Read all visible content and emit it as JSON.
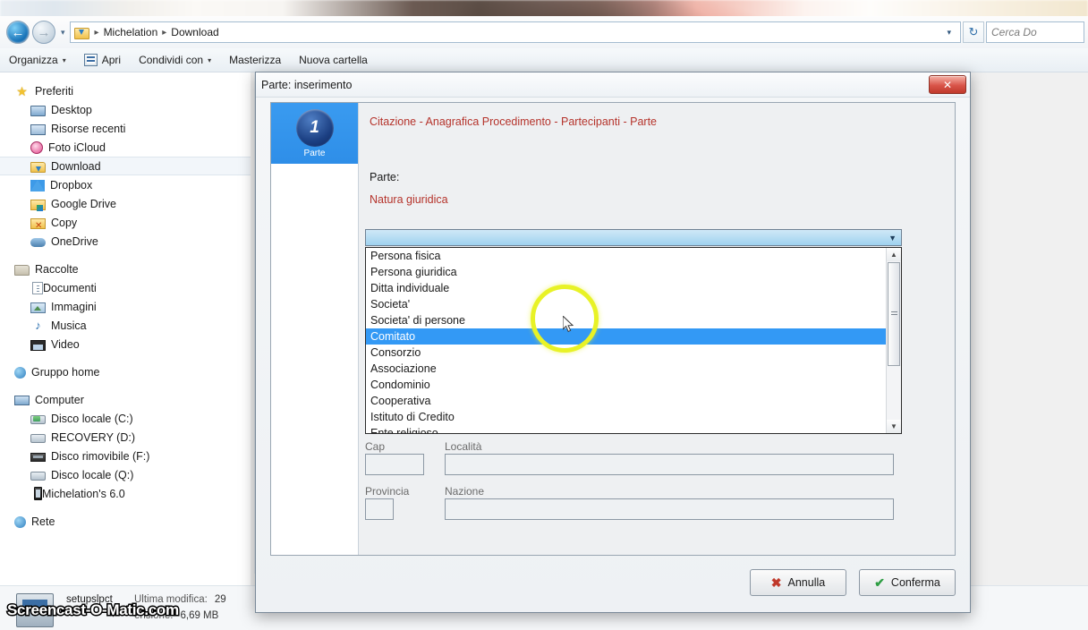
{
  "explorer": {
    "address": {
      "crumbs": [
        "Michelation",
        "Download"
      ],
      "separator": "▸",
      "history_caret": "▾",
      "dropdown_caret": "▾",
      "refresh_icon": "refresh-icon",
      "back_icon": "back-arrow-icon",
      "forward_icon": "forward-arrow-icon",
      "folder_icon": "download-folder-icon"
    },
    "search": {
      "placeholder": "Cerca Do",
      "value": ""
    },
    "commandbar": [
      {
        "label": "Organizza",
        "caret": "▾",
        "icon": ""
      },
      {
        "label": "Apri",
        "caret": "",
        "icon": "open-file-icon"
      },
      {
        "label": "Condividi con",
        "caret": "▾",
        "icon": ""
      },
      {
        "label": "Masterizza",
        "caret": "",
        "icon": ""
      },
      {
        "label": "Nuova cartella",
        "caret": "",
        "icon": ""
      }
    ],
    "sidebar": [
      {
        "label": "Preferiti",
        "icon": "star-icon",
        "level": "root",
        "selected": false,
        "cls": "ic-star"
      },
      {
        "label": "Desktop",
        "icon": "monitor-icon",
        "level": "child",
        "selected": false,
        "cls": "ic-monitor"
      },
      {
        "label": "Risorse recenti",
        "icon": "recent-places-icon",
        "level": "child",
        "selected": false,
        "cls": "ic-net"
      },
      {
        "label": "Foto iCloud",
        "icon": "icloud-photos-icon",
        "level": "child",
        "selected": false,
        "cls": "ic-icloud"
      },
      {
        "label": "Download",
        "icon": "download-folder-icon",
        "level": "child",
        "selected": true,
        "cls": "ic-folder dl"
      },
      {
        "label": "Dropbox",
        "icon": "dropbox-icon",
        "level": "child",
        "selected": false,
        "cls": "ic-dropbox"
      },
      {
        "label": "Google Drive",
        "icon": "google-drive-icon",
        "level": "child",
        "selected": false,
        "cls": "ic-gdrive"
      },
      {
        "label": "Copy",
        "icon": "copy-folder-icon",
        "level": "child",
        "selected": false,
        "cls": "ic-copy"
      },
      {
        "label": "OneDrive",
        "icon": "onedrive-icon",
        "level": "child",
        "selected": false,
        "cls": "ic-onedrive"
      },
      {
        "label": "",
        "icon": "",
        "level": "gap",
        "selected": false,
        "cls": ""
      },
      {
        "label": "Raccolte",
        "icon": "libraries-icon",
        "level": "root",
        "selected": false,
        "cls": "ic-lib"
      },
      {
        "label": "Documenti",
        "icon": "documents-icon",
        "level": "child",
        "selected": false,
        "cls": "ic-doc"
      },
      {
        "label": "Immagini",
        "icon": "pictures-icon",
        "level": "child",
        "selected": false,
        "cls": "ic-img"
      },
      {
        "label": "Musica",
        "icon": "music-note-icon",
        "level": "child",
        "selected": false,
        "cls": "ic-music"
      },
      {
        "label": "Video",
        "icon": "video-icon",
        "level": "child",
        "selected": false,
        "cls": "ic-video"
      },
      {
        "label": "",
        "icon": "",
        "level": "gap",
        "selected": false,
        "cls": ""
      },
      {
        "label": "Gruppo home",
        "icon": "homegroup-icon",
        "level": "root",
        "selected": false,
        "cls": "ic-home"
      },
      {
        "label": "",
        "icon": "",
        "level": "gap",
        "selected": false,
        "cls": ""
      },
      {
        "label": "Computer",
        "icon": "computer-icon",
        "level": "root",
        "selected": false,
        "cls": "ic-comp"
      },
      {
        "label": "Disco locale (C:)",
        "icon": "system-drive-icon",
        "level": "child",
        "selected": false,
        "cls": "ic-hdd c"
      },
      {
        "label": "RECOVERY (D:)",
        "icon": "hard-drive-icon",
        "level": "child",
        "selected": false,
        "cls": "ic-hdd"
      },
      {
        "label": "Disco rimovibile (F:)",
        "icon": "removable-drive-icon",
        "level": "child",
        "selected": false,
        "cls": "ic-usb"
      },
      {
        "label": "Disco locale (Q:)",
        "icon": "hard-drive-icon",
        "level": "child",
        "selected": false,
        "cls": "ic-hdd"
      },
      {
        "label": "Michelation's 6.0",
        "icon": "phone-icon",
        "level": "child",
        "selected": false,
        "cls": "ic-phone"
      },
      {
        "label": "",
        "icon": "",
        "level": "gap",
        "selected": false,
        "cls": ""
      },
      {
        "label": "Rete",
        "icon": "network-icon",
        "level": "root",
        "selected": false,
        "cls": "ic-rete"
      }
    ],
    "details": {
      "filename": "setupslpct",
      "modified_label": "Ultima modifica:",
      "modified_value": "29",
      "size_label": "ensione:",
      "size_value": "6,69 MB"
    }
  },
  "dialog": {
    "title": "Parte: inserimento",
    "close_label": "✕",
    "breadcrumb": "Citazione - Anagrafica Procedimento - Partecipanti - Parte",
    "step": {
      "number": "1",
      "label": "Parte"
    },
    "parte_label": "Parte:",
    "natura_label": "Natura giuridica",
    "combo": {
      "value": "",
      "caret": "▼"
    },
    "options": [
      "Persona fisica",
      "Persona giuridica",
      "Ditta individuale",
      "Societa'",
      "Societa' di persone",
      "Comitato",
      "Consorzio",
      "Associazione",
      "Condominio",
      "Cooperativa",
      "Istituto di Credito",
      "Ente religioso"
    ],
    "selected_option": "Comitato",
    "scroll": {
      "up": "▲",
      "down": "▼"
    },
    "fields": [
      {
        "label": "Cap",
        "value": ""
      },
      {
        "label": "Località",
        "value": ""
      },
      {
        "label": "Provincia",
        "value": ""
      },
      {
        "label": "Nazione",
        "value": ""
      }
    ],
    "buttons": {
      "cancel": {
        "label": "Annulla",
        "glyph": "✖",
        "icon": "red-x-icon"
      },
      "confirm": {
        "label": "Conferma",
        "glyph": "✔",
        "icon": "green-check-icon"
      }
    }
  },
  "watermark": "Screencast-O-Matic.com",
  "colors": {
    "highlight": "#3399f5",
    "accent_red": "#b5332b",
    "cursor_ring": "#e8f226",
    "close_button": "#c0392b"
  }
}
